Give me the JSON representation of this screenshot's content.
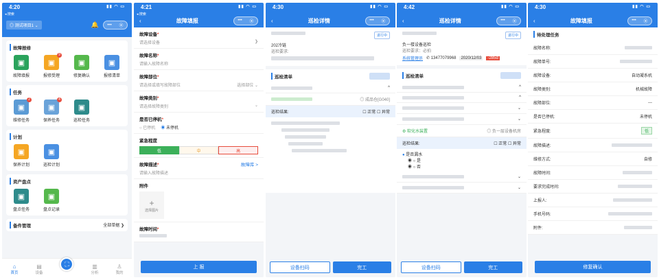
{
  "home": {
    "time": "4:20",
    "back": "◂ 搜索",
    "project": "测试项目1",
    "sections": [
      {
        "title": "故障报修",
        "items": [
          {
            "label": "故障填报",
            "color": "#2aa35c",
            "badge": ""
          },
          {
            "label": "报修受理",
            "color": "#f5a623",
            "badge": "9"
          },
          {
            "label": "修复确认",
            "color": "#55b84c",
            "badge": ""
          },
          {
            "label": "报修清单",
            "color": "#4a90e2",
            "badge": ""
          }
        ]
      },
      {
        "title": "任务",
        "items": [
          {
            "label": "维修任务",
            "color": "#5b9bd5",
            "badge": "2"
          },
          {
            "label": "保养任务",
            "color": "#6aa3d9",
            "badge": "4"
          },
          {
            "label": "巡检任务",
            "color": "#2e8b8b",
            "badge": ""
          }
        ]
      },
      {
        "title": "计划",
        "items": [
          {
            "label": "保养计划",
            "color": "#f5a623",
            "badge": ""
          },
          {
            "label": "巡检计划",
            "color": "#4a90e2",
            "badge": ""
          }
        ]
      },
      {
        "title": "资产盘点",
        "items": [
          {
            "label": "盘点任务",
            "color": "#2e8b8b",
            "badge": ""
          },
          {
            "label": "盘点记录",
            "color": "#55b84c",
            "badge": ""
          }
        ]
      }
    ],
    "spare": "备件管理",
    "spare_all": "全部单据 ❯",
    "tabs": [
      "首页",
      "设备",
      "",
      "分析",
      "我的"
    ]
  },
  "report": {
    "time": "4:21",
    "title": "故障填报",
    "fields": [
      {
        "label": "故障设备",
        "ph": "请选择设备",
        "right": "❯"
      },
      {
        "label": "故障名称",
        "ph": "请输入故障名称",
        "right": ""
      },
      {
        "label": "故障部位",
        "ph": "请选择或填写故障部位",
        "right": "选择部位 ⌄"
      },
      {
        "label": "故障类别",
        "ph": "请选择故障类别",
        "right": "⌄"
      }
    ],
    "stopped_label": "是否已停机",
    "opt_yes": "已停机",
    "opt_no": "未停机",
    "urgency_label": "紧急程度",
    "low": "低",
    "mid": "中",
    "high": "高",
    "desc_label": "故障描述",
    "desc_link": "故障库 >",
    "desc_ph": "请输入故障描述",
    "attach_label": "附件",
    "attach_btn": "选择图片",
    "time_label": "故障时间",
    "submit": "上 报"
  },
  "insp1": {
    "time": "4:30",
    "title": "巡检详情",
    "status": "进行中",
    "line1": "202冷链",
    "line2": "巡检要求:",
    "list_title": "巡检清单",
    "bd_loc": "成品仓[G040]",
    "result": "巡检结果:",
    "normal": "正常",
    "abnormal": "异常",
    "scan": "设备扫码",
    "done": "完工"
  },
  "insp2": {
    "time": "4:42",
    "title": "巡检详情",
    "status": "进行中",
    "line1": "负一楼设备巡检",
    "req": "巡检要求：必拍",
    "sys": "系统管理员",
    "phone": "13477079968",
    "date": "2020/12/03",
    "overdue": "-285d",
    "list_title": "巡检清单",
    "item": "软化水装置",
    "item_loc": "负一层设备机房",
    "result": "巡检结果:",
    "normal": "正常",
    "abnormal": "异常",
    "leak": "是否漏水",
    "yes": "是",
    "no": "否",
    "scan": "设备扫码",
    "done": "完工"
  },
  "confirm": {
    "time": "4:30",
    "title": "故障填报",
    "sec": "待处理任务",
    "rows": [
      {
        "k": "故障名称:",
        "v": ""
      },
      {
        "k": "故障单号:",
        "v": ""
      },
      {
        "k": "故障设备:",
        "v": "自动凝系机"
      },
      {
        "k": "故障类别:",
        "v": "机械故障"
      },
      {
        "k": "故障部位:",
        "v": "---"
      },
      {
        "k": "是否已停机:",
        "v": "未停机"
      },
      {
        "k": "紧急程度:",
        "v": "低"
      },
      {
        "k": "故障描述:",
        "v": ""
      },
      {
        "k": "维修方式:",
        "v": "自修"
      },
      {
        "k": "故障时间:",
        "v": ""
      },
      {
        "k": "要求完成时间:",
        "v": ""
      },
      {
        "k": "上报人:",
        "v": ""
      },
      {
        "k": "手机号码:",
        "v": ""
      },
      {
        "k": "附件:",
        "v": ""
      }
    ],
    "btn": "修复确认"
  }
}
